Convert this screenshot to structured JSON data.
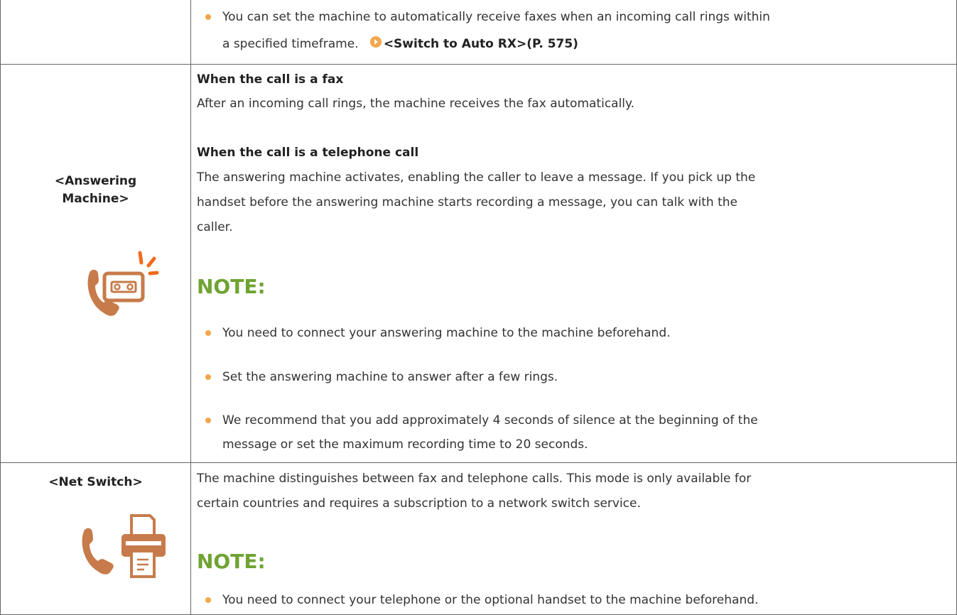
{
  "row_top": {
    "bullet_line1": "You can set the machine to automatically receive faxes when an incoming call rings within",
    "bullet_line2": "a specified timeframe.",
    "link_text": "<Switch to Auto RX>(P. 575)"
  },
  "answering": {
    "label_line1": "<Answering",
    "label_line2": "Machine>",
    "fax_heading": "When the call is a fax",
    "fax_text": "After an incoming call rings, the machine receives the fax automatically.",
    "tel_heading": "When the call is a telephone call",
    "tel_line1": "The answering machine activates, enabling the caller to leave a message. If you pick up the",
    "tel_line2": "handset before the answering machine starts recording a message, you can talk with the",
    "tel_line3": "caller.",
    "note_title": "NOTE:",
    "notes": [
      "You need to connect your answering machine to the machine beforehand.",
      "Set the answering machine to answer after a few rings.",
      "We recommend that you add approximately 4 seconds of silence at the beginning of the"
    ],
    "note3_line2": "message or set the maximum recording time to 20 seconds."
  },
  "netswitch": {
    "label": "<Net Switch>",
    "desc_line1": "The machine distinguishes between fax and telephone calls. This mode is only available for",
    "desc_line2": "certain countries and requires a subscription to a network switch service.",
    "note_title": "NOTE:",
    "note1": "You need to connect your telephone or the optional handset to the machine beforehand."
  },
  "colors": {
    "note_green": "#6fa332",
    "bullet_orange": "#f3a64a",
    "icon_orange": "#c77b4a",
    "border": "#666666"
  },
  "icons": [
    "link-arrow-icon",
    "phone-icon",
    "cassette-tape-icon",
    "ring-lines-icon",
    "printer-icon"
  ]
}
